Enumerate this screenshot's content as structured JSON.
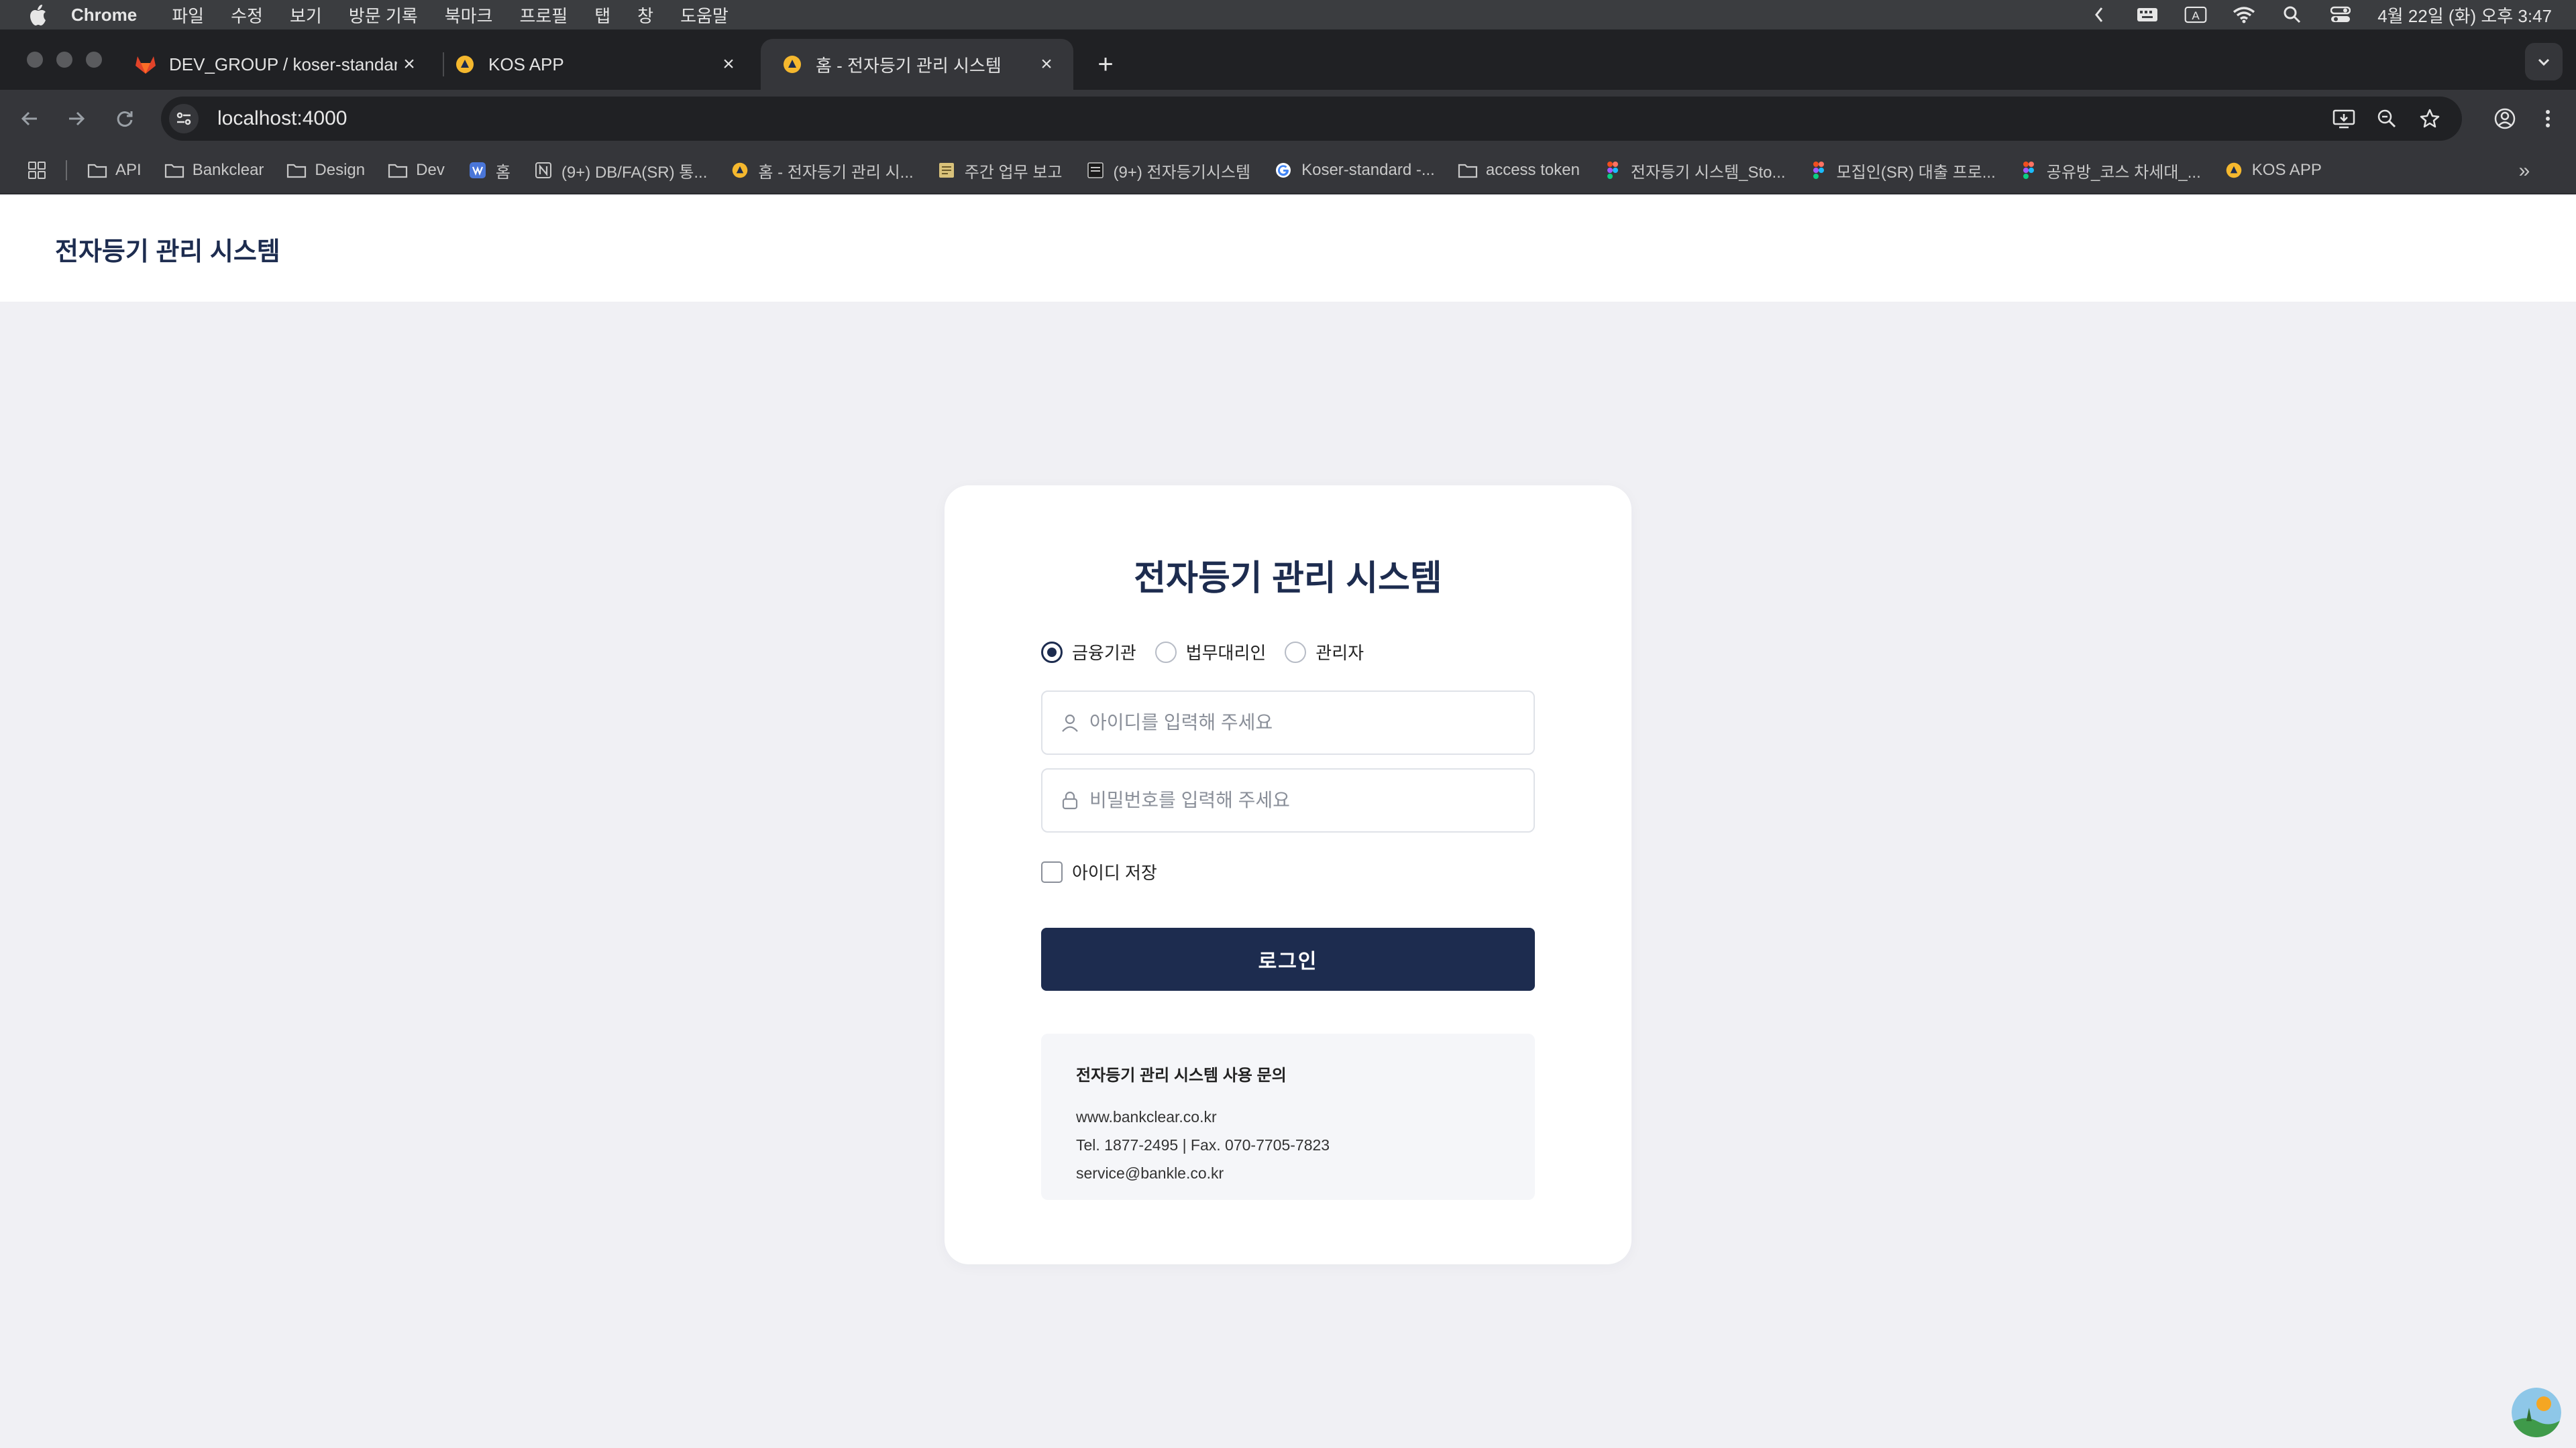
{
  "menubar": {
    "app": "Chrome",
    "items": [
      "파일",
      "수정",
      "보기",
      "방문 기록",
      "북마크",
      "프로필",
      "탭",
      "창",
      "도움말"
    ],
    "clock": "4월 22일 (화) 오후 3:47",
    "input_indicator": "A"
  },
  "tabs": [
    {
      "title": "DEV_GROUP / koser-standard",
      "favicon": "gitlab-icon"
    },
    {
      "title": "KOS APP",
      "favicon": "kos-logo-icon"
    },
    {
      "title": "홈 - 전자등기 관리 시스템",
      "favicon": "kos-logo-icon",
      "active": true
    }
  ],
  "toolbar": {
    "url": "localhost:4000"
  },
  "bookmarks": [
    {
      "label": "API",
      "icon": "folder-icon"
    },
    {
      "label": "Bankclear",
      "icon": "folder-icon"
    },
    {
      "label": "Design",
      "icon": "folder-icon"
    },
    {
      "label": "Dev",
      "icon": "folder-icon"
    },
    {
      "label": "홈",
      "icon": "app-icon"
    },
    {
      "label": "(9+) DB/FA(SR) 통...",
      "icon": "notion-icon"
    },
    {
      "label": "홈 - 전자등기 관리 시...",
      "icon": "kos-logo-icon"
    },
    {
      "label": "주간 업무 보고",
      "icon": "note-icon"
    },
    {
      "label": "(9+) 전자등기시스템",
      "icon": "note-icon"
    },
    {
      "label": "Koser-standard -...",
      "icon": "google-icon"
    },
    {
      "label": "access token",
      "icon": "folder-icon"
    },
    {
      "label": "전자등기 시스템_Sto...",
      "icon": "figma-icon"
    },
    {
      "label": "모집인(SR) 대출 프로...",
      "icon": "figma-icon"
    },
    {
      "label": "공유방_코스 차세대_...",
      "icon": "figma-icon"
    },
    {
      "label": "KOS APP",
      "icon": "kos-logo-icon"
    }
  ],
  "page": {
    "header_brand": "전자등기 관리 시스템",
    "login": {
      "title": "전자등기 관리 시스템",
      "roles": [
        {
          "label": "금융기관",
          "checked": true
        },
        {
          "label": "법무대리인",
          "checked": false
        },
        {
          "label": "관리자",
          "checked": false
        }
      ],
      "id_placeholder": "아이디를 입력해 주세요",
      "id_value": "",
      "password_placeholder": "비밀번호를 입력해 주세요",
      "password_value": "",
      "remember_label": "아이디 저장",
      "remember_checked": false,
      "submit_label": "로그인"
    },
    "contact": {
      "title": "전자등기 관리 시스템 사용 문의",
      "website": "www.bankclear.co.kr",
      "phone": "Tel. 1877-2495 | Fax. 070-7705-7823",
      "email": "service@bankle.co.kr"
    }
  },
  "colors": {
    "primary": "#1d2c4f",
    "page_bg": "#f0f0f4",
    "card_bg": "#ffffff",
    "contact_bg": "#f5f6f9",
    "chrome_dark": "#202124",
    "chrome_toolbar": "#35363a"
  }
}
